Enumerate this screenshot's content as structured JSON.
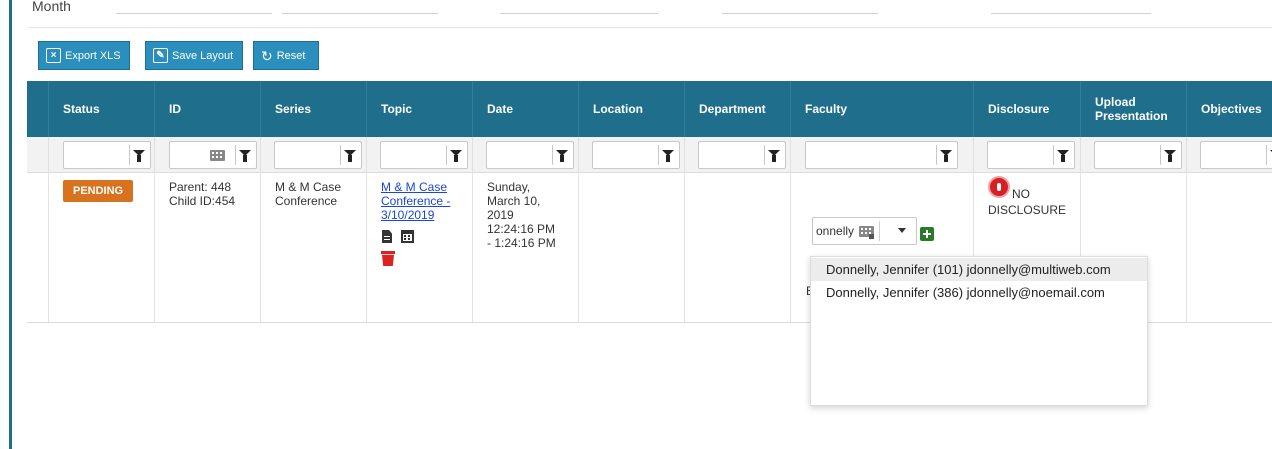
{
  "filters_top": {
    "month_label": "Month"
  },
  "toolbar": {
    "export_label": "Export XLS",
    "save_layout_label": "Save Layout",
    "reset_label": "Reset"
  },
  "columns": [
    {
      "label": "Status"
    },
    {
      "label": "ID"
    },
    {
      "label": "Series"
    },
    {
      "label": "Topic"
    },
    {
      "label": "Date"
    },
    {
      "label": "Location"
    },
    {
      "label": "Department"
    },
    {
      "label": "Faculty"
    },
    {
      "label": "Disclosure"
    },
    {
      "label": "Upload Presentation"
    },
    {
      "label": "Objectives"
    }
  ],
  "row": {
    "status": "PENDING",
    "id_line1": "Parent: 448",
    "id_line2": "Child ID:454",
    "series_line1": "M & M Case",
    "series_line2": "Conference",
    "topic_line1": "M & M Case",
    "topic_line2": "Conference -",
    "topic_line3": "3/10/2019",
    "date_line1": "Sunday,",
    "date_line2": "March 10,",
    "date_line3": "2019",
    "date_line4": "12:24:16 PM",
    "date_line5": "- 1:24:16 PM",
    "disclosure_line1": "NO",
    "disclosure_line2": "DISCLOSURE",
    "faculty_hidden_fragment": "E"
  },
  "faculty_search": {
    "value": "onnelly",
    "options": [
      {
        "label": "Donnelly, Jennifer (101) jdonnelly@multiweb.com",
        "highlighted": true
      },
      {
        "label": "Donnelly, Jennifer (386) jdonnelly@noemail.com",
        "highlighted": false
      }
    ]
  },
  "colors": {
    "header_bg": "#1f6e8c",
    "toolbar_btn": "#2a8fbd",
    "pending_badge": "#d9721f",
    "link": "#1a45e0",
    "delete_red": "#dd2222",
    "add_green": "#2a7a2a"
  },
  "icons": {
    "export": "excel-icon",
    "save_layout": "edit-icon",
    "reset": "refresh-icon",
    "filter": "funnel-icon",
    "topic_actions": [
      "document-icon",
      "calendar-icon",
      "trash-icon"
    ],
    "disclosure": "stop-hand-icon",
    "faculty_add": "plus-square-icon"
  }
}
